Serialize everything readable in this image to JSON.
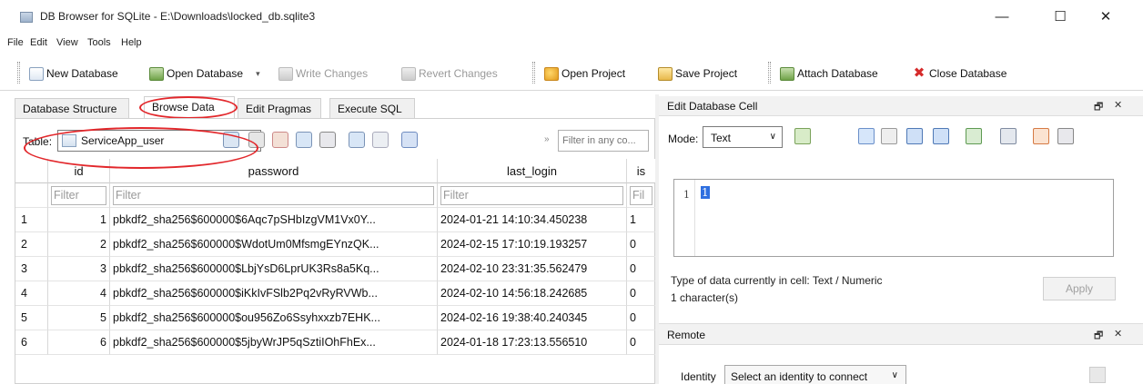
{
  "window": {
    "title": "DB Browser for SQLite - E:\\Downloads\\locked_db.sqlite3",
    "controls": {
      "minimize": "—",
      "maximize": "☐",
      "close": "✕"
    }
  },
  "menu": [
    "File",
    "Edit",
    "View",
    "Tools",
    "Help"
  ],
  "toolbar": {
    "new_database": "New Database",
    "open_database": "Open Database",
    "write_changes": "Write Changes",
    "revert_changes": "Revert Changes",
    "open_project": "Open Project",
    "save_project": "Save Project",
    "attach_database": "Attach Database",
    "close_database": "Close Database"
  },
  "tabs": [
    "Database Structure",
    "Browse Data",
    "Edit Pragmas",
    "Execute SQL"
  ],
  "active_tab": "Browse Data",
  "browse": {
    "table_label": "Table:",
    "table_selected": "ServiceApp_user",
    "filter_any_placeholder": "Filter in any co...",
    "filter_arrows": "»",
    "columns": [
      "id",
      "password",
      "last_login",
      "is"
    ],
    "filter_placeholders": [
      "Filter",
      "Filter",
      "Filter",
      "Fil"
    ],
    "rows": [
      {
        "rownum": "1",
        "id": "1",
        "password": "pbkdf2_sha256$600000$6Aqc7pSHbIzgVM1Vx0Y...",
        "last_login": "2024-01-21 14:10:34.450238",
        "is": "1"
      },
      {
        "rownum": "2",
        "id": "2",
        "password": "pbkdf2_sha256$600000$WdotUm0MfsmgEYnzQK...",
        "last_login": "2024-02-15 17:10:19.193257",
        "is": "0"
      },
      {
        "rownum": "3",
        "id": "3",
        "password": "pbkdf2_sha256$600000$LbjYsD6LprUK3Rs8a5Kq...",
        "last_login": "2024-02-10 23:31:35.562479",
        "is": "0"
      },
      {
        "rownum": "4",
        "id": "4",
        "password": "pbkdf2_sha256$600000$iKkIvFSlb2Pq2vRyRVWb...",
        "last_login": "2024-02-10 14:56:18.242685",
        "is": "0"
      },
      {
        "rownum": "5",
        "id": "5",
        "password": "pbkdf2_sha256$600000$ou956Zo6Ssyhxxzb7EHK...",
        "last_login": "2024-02-16 19:38:40.240345",
        "is": "0"
      },
      {
        "rownum": "6",
        "id": "6",
        "password": "pbkdf2_sha256$600000$5jbyWrJP5qSztiIOhFhEx...",
        "last_login": "2024-01-18 17:23:13.556510",
        "is": "0"
      }
    ]
  },
  "edit_cell": {
    "title": "Edit Database Cell",
    "dock_float": "🗗",
    "dock_close": "✕",
    "mode_label": "Mode:",
    "mode_value": "Text",
    "editor_line": "1",
    "editor_value": "1",
    "type_info": "Type of data currently in cell: Text / Numeric",
    "char_info": "1 character(s)",
    "apply": "Apply"
  },
  "remote": {
    "title": "Remote",
    "identity_label": "Identity",
    "identity_value": "Select an identity to connect"
  },
  "colors": {
    "annotation_red": "#e2272b",
    "selection_blue": "#2f6fe0"
  }
}
